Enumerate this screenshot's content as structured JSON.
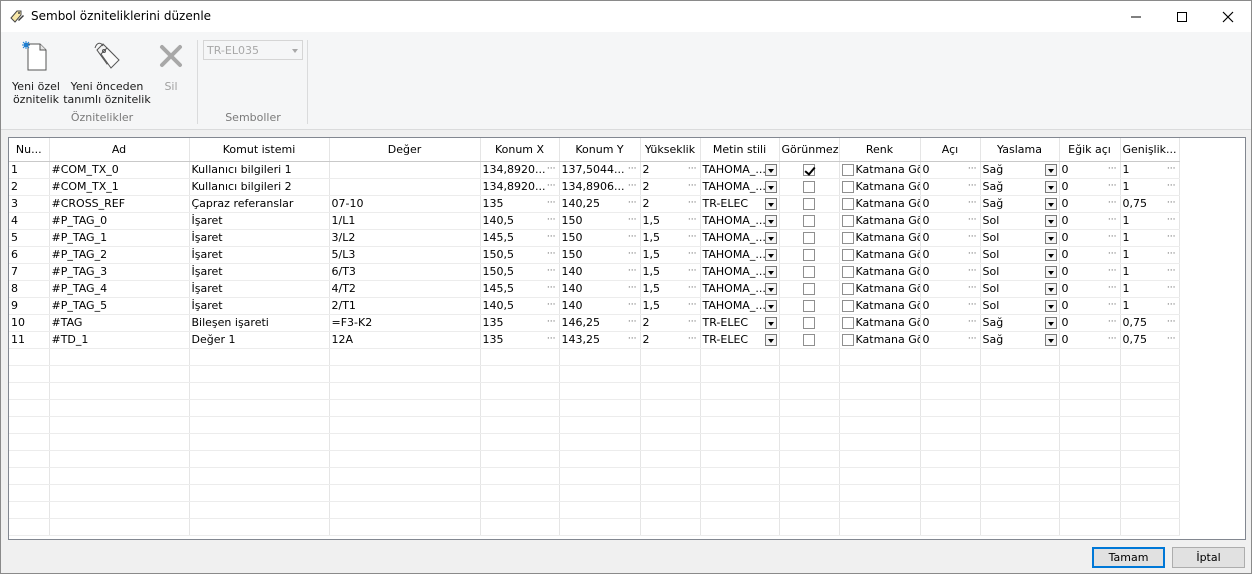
{
  "window": {
    "title": "Sembol özniteliklerini düzenle"
  },
  "ribbon": {
    "new_custom_attr": "Yeni özel\nöznitelik",
    "new_custom_attr_l1": "Yeni özel",
    "new_custom_attr_l2": "öznitelik",
    "new_predef_attr_l1": "Yeni önceden",
    "new_predef_attr_l2": "tanımlı öznitelik",
    "delete": "Sil",
    "group_attributes": "Öznitelikler",
    "group_symbols": "Semboller",
    "symbol_combo_value": "TR-EL035"
  },
  "table": {
    "headers": [
      "Nu...",
      "Ad",
      "Komut istemi",
      "Değer",
      "Konum X",
      "Konum Y",
      "Yükseklik",
      "Metin stili",
      "Görünmez",
      "Renk",
      "Açı",
      "Yaslama",
      "Eğik açı",
      "Genişlik..."
    ],
    "rows": [
      {
        "nu": "1",
        "ad": "#COM_TX_0",
        "komut": "Kullanıcı bilgileri 1",
        "deger": "",
        "x": "134,8920...",
        "y": "137,5044...",
        "h": "2",
        "stil": "TAHOMA_...",
        "gorunmez": true,
        "renk": "Katmana Göre",
        "aci": "0",
        "yaslama": "Sağ",
        "egik": "0",
        "genislik": "1"
      },
      {
        "nu": "2",
        "ad": "#COM_TX_1",
        "komut": "Kullanıcı bilgileri 2",
        "deger": "",
        "x": "134,8920...",
        "y": "134,8906...",
        "h": "2",
        "stil": "TAHOMA_...",
        "gorunmez": false,
        "renk": "Katmana Göre",
        "aci": "0",
        "yaslama": "Sağ",
        "egik": "0",
        "genislik": "1"
      },
      {
        "nu": "3",
        "ad": "#CROSS_REF",
        "komut": "Çapraz referanslar",
        "deger": "07-10",
        "x": "135",
        "y": "140,25",
        "h": "2",
        "stil": "TR-ELEC",
        "gorunmez": false,
        "renk": "Katmana Göre",
        "aci": "0",
        "yaslama": "Sağ",
        "egik": "0",
        "genislik": "0,75"
      },
      {
        "nu": "4",
        "ad": "#P_TAG_0",
        "komut": "İşaret",
        "deger": "1/L1",
        "x": "140,5",
        "y": "150",
        "h": "1,5",
        "stil": "TAHOMA_...",
        "gorunmez": false,
        "renk": "Katmana Göre",
        "aci": "0",
        "yaslama": "Sol",
        "egik": "0",
        "genislik": "1"
      },
      {
        "nu": "5",
        "ad": "#P_TAG_1",
        "komut": "İşaret",
        "deger": "3/L2",
        "x": "145,5",
        "y": "150",
        "h": "1,5",
        "stil": "TAHOMA_...",
        "gorunmez": false,
        "renk": "Katmana Göre",
        "aci": "0",
        "yaslama": "Sol",
        "egik": "0",
        "genislik": "1"
      },
      {
        "nu": "6",
        "ad": "#P_TAG_2",
        "komut": "İşaret",
        "deger": "5/L3",
        "x": "150,5",
        "y": "150",
        "h": "1,5",
        "stil": "TAHOMA_...",
        "gorunmez": false,
        "renk": "Katmana Göre",
        "aci": "0",
        "yaslama": "Sol",
        "egik": "0",
        "genislik": "1"
      },
      {
        "nu": "7",
        "ad": "#P_TAG_3",
        "komut": "İşaret",
        "deger": "6/T3",
        "x": "150,5",
        "y": "140",
        "h": "1,5",
        "stil": "TAHOMA_...",
        "gorunmez": false,
        "renk": "Katmana Göre",
        "aci": "0",
        "yaslama": "Sol",
        "egik": "0",
        "genislik": "1"
      },
      {
        "nu": "8",
        "ad": "#P_TAG_4",
        "komut": "İşaret",
        "deger": "4/T2",
        "x": "145,5",
        "y": "140",
        "h": "1,5",
        "stil": "TAHOMA_...",
        "gorunmez": false,
        "renk": "Katmana Göre",
        "aci": "0",
        "yaslama": "Sol",
        "egik": "0",
        "genislik": "1"
      },
      {
        "nu": "9",
        "ad": "#P_TAG_5",
        "komut": "İşaret",
        "deger": "2/T1",
        "x": "140,5",
        "y": "140",
        "h": "1,5",
        "stil": "TAHOMA_...",
        "gorunmez": false,
        "renk": "Katmana Göre",
        "aci": "0",
        "yaslama": "Sol",
        "egik": "0",
        "genislik": "1"
      },
      {
        "nu": "10",
        "ad": "#TAG",
        "komut": "Bileşen işareti",
        "deger": "=F3-K2",
        "x": "135",
        "y": "146,25",
        "h": "2",
        "stil": "TR-ELEC",
        "gorunmez": false,
        "renk": "Katmana Göre",
        "aci": "0",
        "yaslama": "Sağ",
        "egik": "0",
        "genislik": "0,75"
      },
      {
        "nu": "11",
        "ad": "#TD_1",
        "komut": "Değer 1",
        "deger": "12A",
        "x": "135",
        "y": "143,25",
        "h": "2",
        "stil": "TR-ELEC",
        "gorunmez": false,
        "renk": "Katmana Göre",
        "aci": "0",
        "yaslama": "Sağ",
        "egik": "0",
        "genislik": "0,75"
      }
    ],
    "empty_rows": 11
  },
  "footer": {
    "ok": "Tamam",
    "cancel": "İptal"
  }
}
